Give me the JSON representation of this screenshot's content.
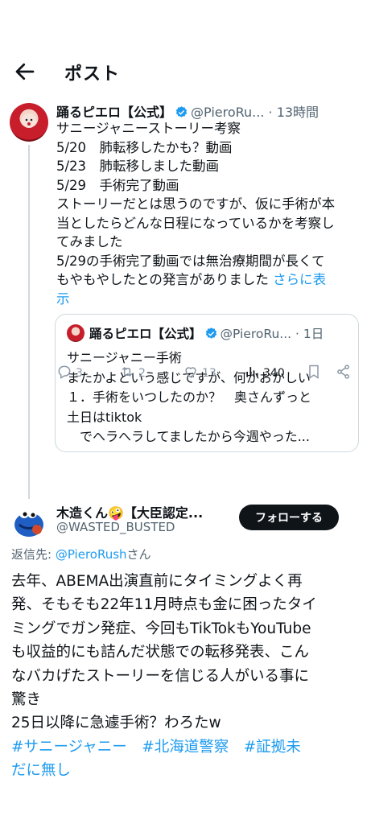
{
  "header": {
    "title": "ポスト"
  },
  "tweet1": {
    "name": "踊るピエロ【公式】",
    "handle": "@PieroRu...",
    "time": "· 13時間",
    "body_lines": [
      "サニージャニーストーリー考察",
      "5/20　肺転移したかも？動画",
      "5/23　肺転移しました動画",
      "5/29　手術完了動画",
      "ストーリーだとは思うのですが、仮に手術が本",
      "当としたらどんな日程になっているかを考察し",
      "てみました",
      "5/29の手術完了動画では無治療期間が長くて",
      "もやもやしたとの発言がありました "
    ],
    "show_more": "さらに表",
    "show_more_2": "示",
    "quote": {
      "name": "踊るピエロ【公式】",
      "handle": "@PieroRu...",
      "time": "· 1日",
      "body": "サニージャニー手術\nまたかよという感じですが、何かおかしい\n１．手術をいつしたのか？　奥さんずっと\n土日はtiktok\n　でヘラヘラしてましたから今週やった..."
    },
    "actions": {
      "replies": "3",
      "reposts": "2",
      "likes": "13",
      "views": "340"
    }
  },
  "tweet2": {
    "name": "木造くん🤪【大臣認定...",
    "handle": "@WASTED_BUSTED",
    "follow_label": "フォローする",
    "reply_prefix": "返信先: ",
    "reply_handle": "@PieroRush",
    "reply_suffix": "さん",
    "body": "去年、ABEMA出演直前にタイミングよく再\n発、そもそも22年11月時点も金に困ったタイ\nミングでガン発症、今回もTikTokもYouTube\nも収益的にも詰んだ状態での転移発表、こん\nなバカげたストーリーを信じる人がいる事に\n驚き\n25日以降に急遽手術？わろたw",
    "hashtag1": "#サニージャニー",
    "hashtag2": "#北海道警察",
    "hashtag3": "#証拠未",
    "hashtag3_cont": "だに無し"
  },
  "colors": {
    "accent": "#1d9bf0",
    "text": "#0f1419",
    "muted": "#536471"
  }
}
